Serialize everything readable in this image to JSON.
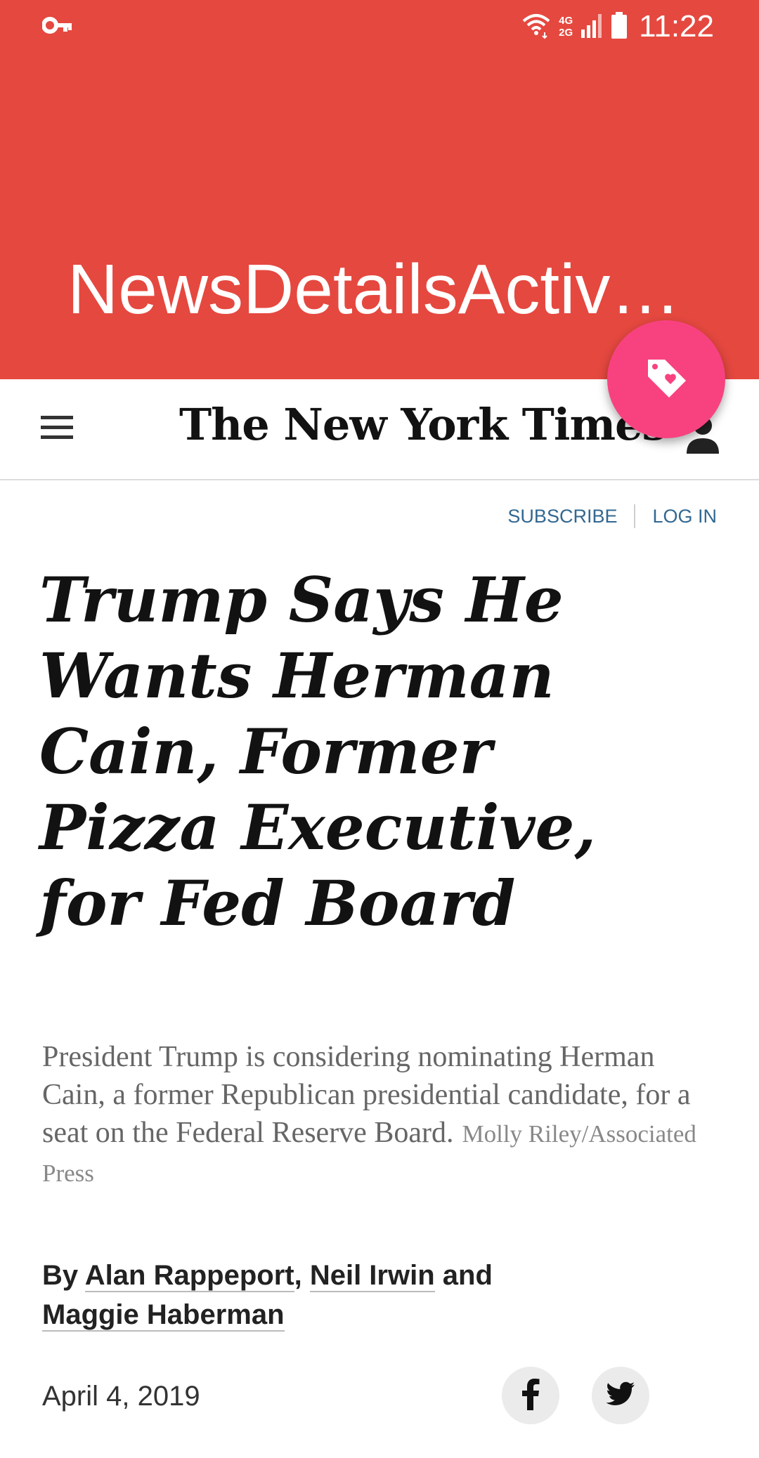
{
  "status_bar": {
    "time": "11:22",
    "network_top": "4G",
    "network_bottom": "2G",
    "icons": [
      "vpn-key-icon",
      "wifi-icon",
      "signal-icon",
      "battery-icon"
    ]
  },
  "app_bar": {
    "title": "NewsDetailsActiv…",
    "color": "#e5483f"
  },
  "fab": {
    "icon": "tag-heart-icon",
    "color": "#f8427f"
  },
  "nyt_header": {
    "logo": "The New York Times",
    "menu_icon": "hamburger-menu-icon",
    "account_icon": "account-icon"
  },
  "auth": {
    "subscribe": "SUBSCRIBE",
    "login": "LOG IN"
  },
  "article": {
    "headline": "Trump Says He Wants Herman Cain, Former Pizza Executive, for Fed Board",
    "caption": "President Trump is considering nominating Herman Cain, a former Republican presidential candidate, for a seat on the Federal Reserve Board.",
    "credit": "Molly Riley/Associated Press",
    "byline": {
      "prefix": "By",
      "author1": "Alan Rappeport",
      "sep1": ",",
      "author2": "Neil Irwin",
      "conj": "and",
      "author3": "Maggie Haberman"
    },
    "date": "April 4, 2019"
  },
  "share": {
    "facebook_icon": "facebook-icon",
    "twitter_icon": "twitter-icon"
  }
}
